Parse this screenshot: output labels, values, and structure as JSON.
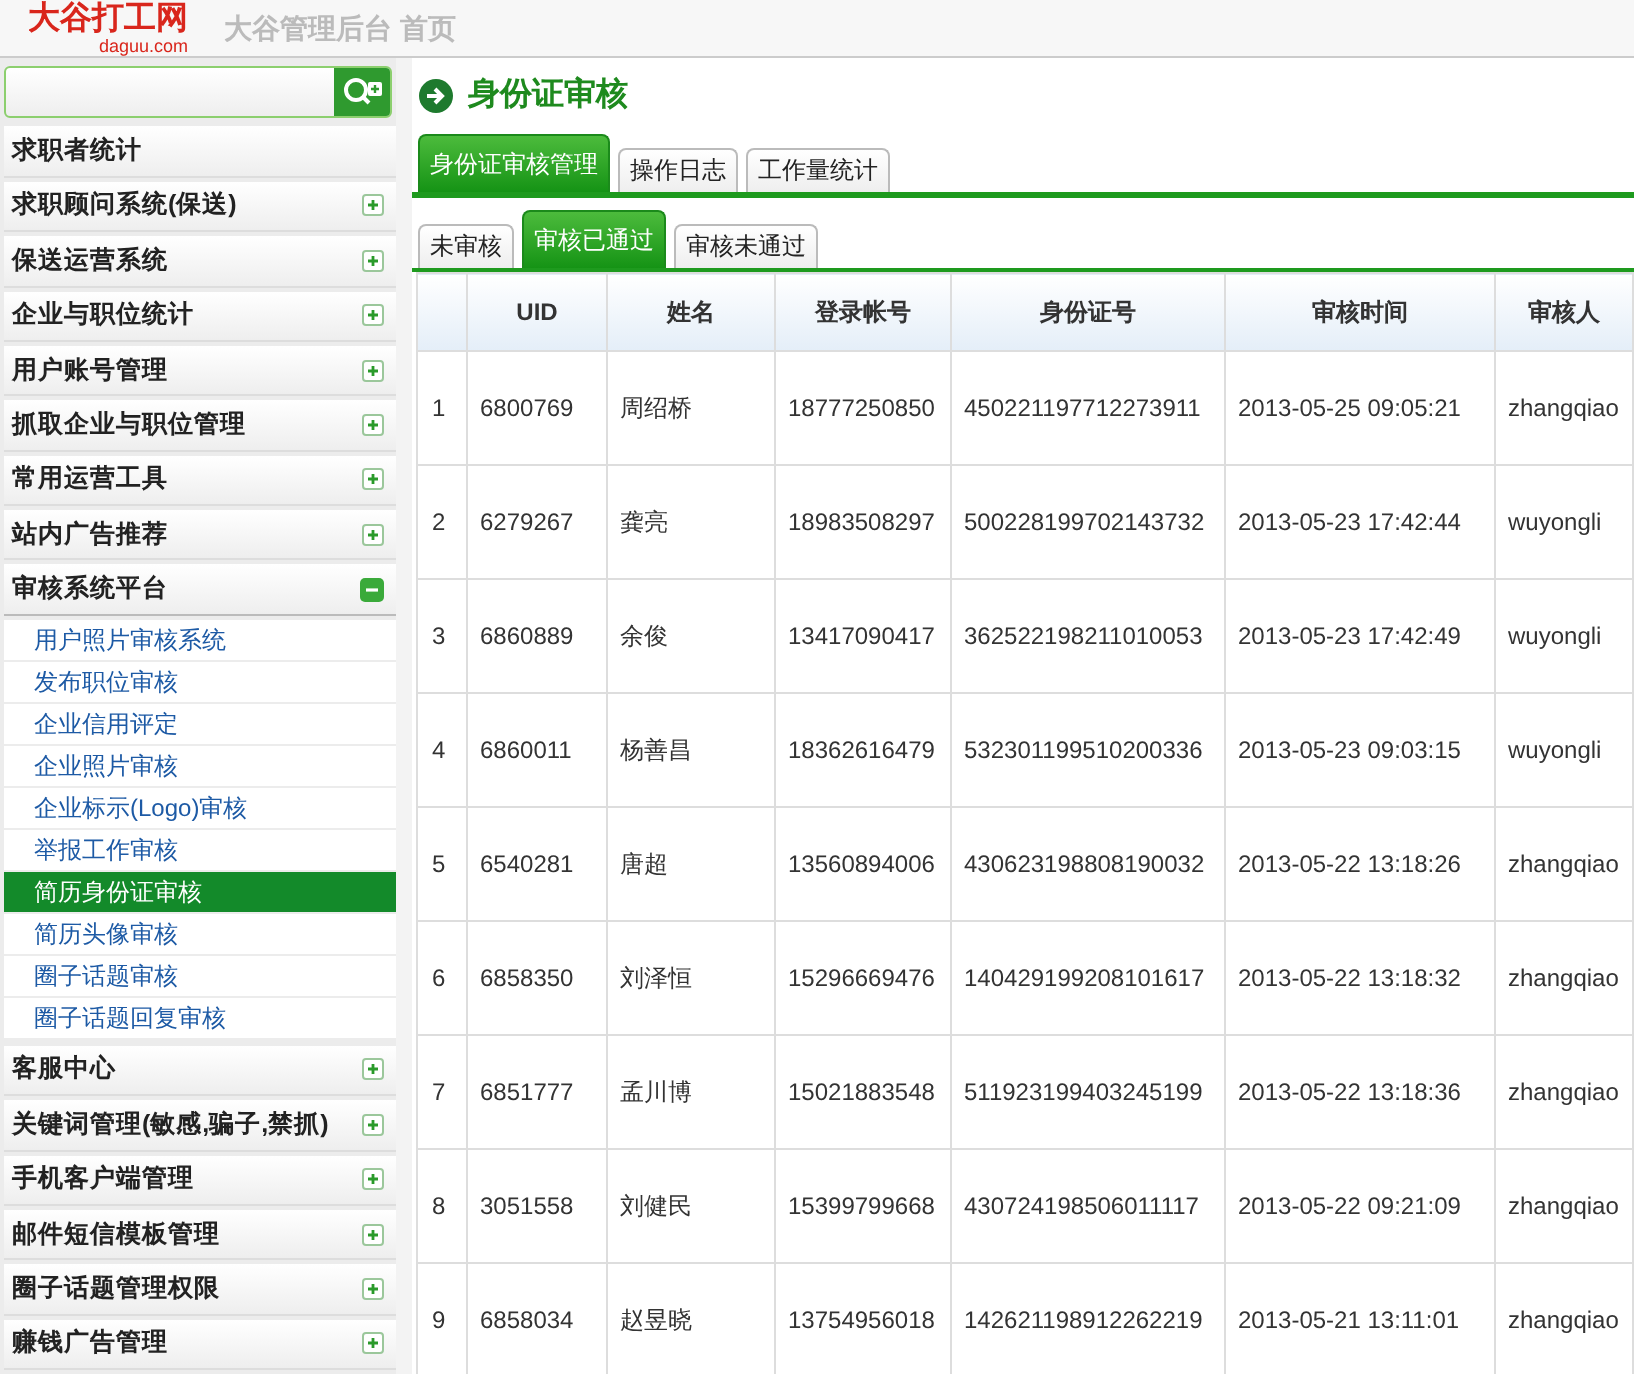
{
  "header": {
    "logo": "大谷打工网",
    "logo_domain": "daguu.com",
    "title": "大谷管理后台 首页"
  },
  "sidebar": {
    "items": [
      {
        "label": "求职者统计",
        "kind": "link"
      },
      {
        "label": "求职顾问系统(保送)",
        "kind": "group",
        "expanded": false
      },
      {
        "label": "保送运营系统",
        "kind": "group",
        "expanded": false
      },
      {
        "label": "企业与职位统计",
        "kind": "group",
        "expanded": false
      },
      {
        "label": "用户账号管理",
        "kind": "group",
        "expanded": false
      },
      {
        "label": "抓取企业与职位管理",
        "kind": "group",
        "expanded": false
      },
      {
        "label": "常用运营工具",
        "kind": "group",
        "expanded": false
      },
      {
        "label": "站内广告推荐",
        "kind": "group",
        "expanded": false
      },
      {
        "label": "审核系统平台",
        "kind": "group",
        "expanded": true,
        "children": [
          {
            "label": "用户照片审核系统",
            "selected": false
          },
          {
            "label": "发布职位审核",
            "selected": false
          },
          {
            "label": "企业信用评定",
            "selected": false
          },
          {
            "label": "企业照片审核",
            "selected": false
          },
          {
            "label": "企业标示(Logo)审核",
            "selected": false
          },
          {
            "label": "举报工作审核",
            "selected": false
          },
          {
            "label": "简历身份证审核",
            "selected": true
          },
          {
            "label": "简历头像审核",
            "selected": false
          },
          {
            "label": "圈子话题审核",
            "selected": false
          },
          {
            "label": "圈子话题回复审核",
            "selected": false
          }
        ]
      },
      {
        "label": "客服中心",
        "kind": "group",
        "expanded": false
      },
      {
        "label": "关键词管理(敏感,骗子,禁抓)",
        "kind": "group",
        "expanded": false
      },
      {
        "label": "手机客户端管理",
        "kind": "group",
        "expanded": false
      },
      {
        "label": "邮件短信模板管理",
        "kind": "group",
        "expanded": false
      },
      {
        "label": "圈子话题管理权限",
        "kind": "group",
        "expanded": false
      },
      {
        "label": "赚钱广告管理",
        "kind": "group",
        "expanded": false
      }
    ]
  },
  "page_title": "身份证审核",
  "tabs": [
    {
      "label": "身份证审核管理",
      "selected": true
    },
    {
      "label": "操作日志",
      "selected": false
    },
    {
      "label": "工作量统计",
      "selected": false
    }
  ],
  "sub_tabs": [
    {
      "label": "未审核",
      "selected": false
    },
    {
      "label": "审核已通过",
      "selected": true
    },
    {
      "label": "审核未通过",
      "selected": false
    }
  ],
  "table": {
    "columns": [
      "",
      "UID",
      "姓名",
      "登录帐号",
      "身份证号",
      "审核时间",
      "审核人"
    ],
    "rows": [
      [
        "1",
        "6800769",
        "周绍桥",
        "18777250850",
        "450221197712273911",
        "2013-05-25 09:05:21",
        "zhangqiao"
      ],
      [
        "2",
        "6279267",
        "龚亮",
        "18983508297",
        "500228199702143732",
        "2013-05-23 17:42:44",
        "wuyongli"
      ],
      [
        "3",
        "6860889",
        "余俊",
        "13417090417",
        "362522198211010053",
        "2013-05-23 17:42:49",
        "wuyongli"
      ],
      [
        "4",
        "6860011",
        "杨善昌",
        "18362616479",
        "532301199510200336",
        "2013-05-23 09:03:15",
        "wuyongli"
      ],
      [
        "5",
        "6540281",
        "唐超",
        "13560894006",
        "430623198808190032",
        "2013-05-22 13:18:26",
        "zhangqiao"
      ],
      [
        "6",
        "6858350",
        "刘泽恒",
        "15296669476",
        "140429199208101617",
        "2013-05-22 13:18:32",
        "zhangqiao"
      ],
      [
        "7",
        "6851777",
        "孟川博",
        "15021883548",
        "511923199403245199",
        "2013-05-22 13:18:36",
        "zhangqiao"
      ],
      [
        "8",
        "3051558",
        "刘健民",
        "15399799668",
        "430724198506011117",
        "2013-05-22 09:21:09",
        "zhangqiao"
      ],
      [
        "9",
        "6858034",
        "赵昱晓",
        "13754956018",
        "142621198912262219",
        "2013-05-21 13:11:01",
        "zhangqiao"
      ]
    ]
  }
}
